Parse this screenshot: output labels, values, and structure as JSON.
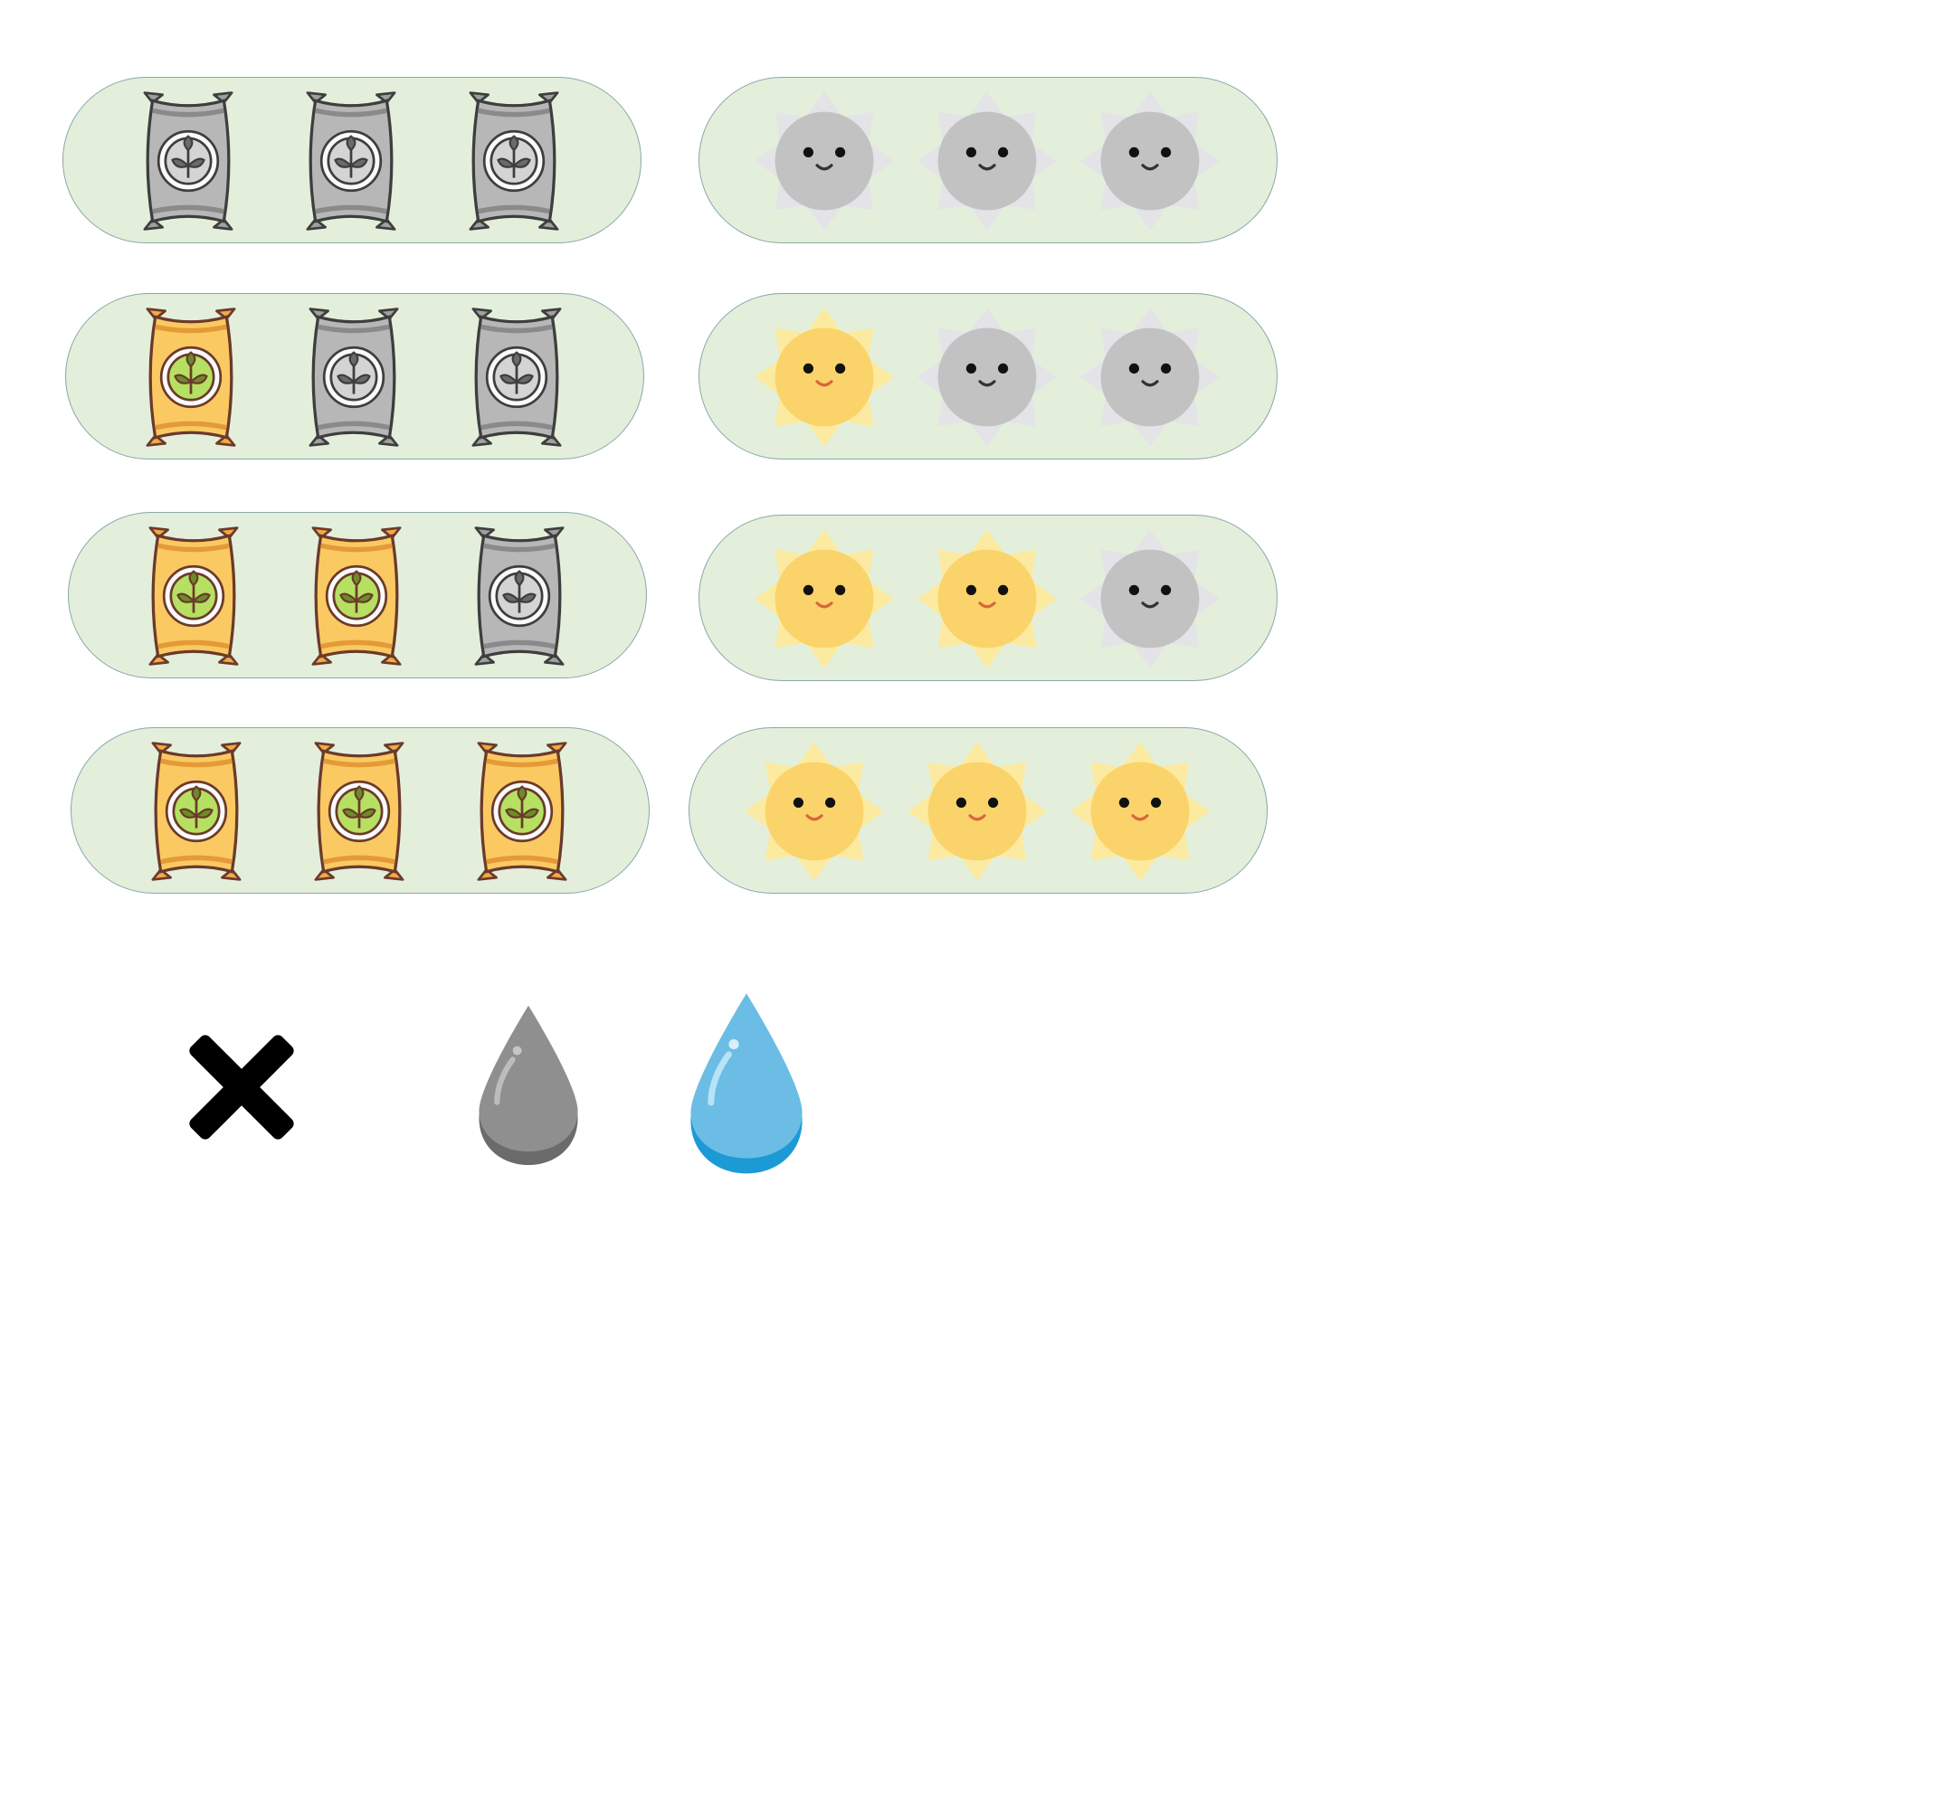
{
  "colors": {
    "panel_fill": "#e3efda",
    "panel_border": "#8aa7aa",
    "bag_active": "#fbc962",
    "bag_inactive": "#b7b7b7",
    "sun_active": "#fad36b",
    "sun_inactive": "#c2c2c2",
    "drop_active": "#6cbde6",
    "drop_inactive": "#8a8a8a"
  },
  "fertilizer_levels": [
    {
      "level": 0,
      "max": 3,
      "icons": [
        "fertilizer-bag-icon-inactive",
        "fertilizer-bag-icon-inactive",
        "fertilizer-bag-icon-inactive"
      ]
    },
    {
      "level": 1,
      "max": 3,
      "icons": [
        "fertilizer-bag-icon-active",
        "fertilizer-bag-icon-inactive",
        "fertilizer-bag-icon-inactive"
      ]
    },
    {
      "level": 2,
      "max": 3,
      "icons": [
        "fertilizer-bag-icon-active",
        "fertilizer-bag-icon-active",
        "fertilizer-bag-icon-inactive"
      ]
    },
    {
      "level": 3,
      "max": 3,
      "icons": [
        "fertilizer-bag-icon-active",
        "fertilizer-bag-icon-active",
        "fertilizer-bag-icon-active"
      ]
    }
  ],
  "sun_levels": [
    {
      "level": 0,
      "max": 3,
      "icons": [
        "sun-icon-inactive",
        "sun-icon-inactive",
        "sun-icon-inactive"
      ]
    },
    {
      "level": 1,
      "max": 3,
      "icons": [
        "sun-icon-active",
        "sun-icon-inactive",
        "sun-icon-inactive"
      ]
    },
    {
      "level": 2,
      "max": 3,
      "icons": [
        "sun-icon-active",
        "sun-icon-active",
        "sun-icon-inactive"
      ]
    },
    {
      "level": 3,
      "max": 3,
      "icons": [
        "sun-icon-active",
        "sun-icon-active",
        "sun-icon-active"
      ]
    }
  ],
  "extra_icons": [
    "close-x-icon",
    "water-drop-icon-inactive",
    "water-drop-icon-active"
  ]
}
